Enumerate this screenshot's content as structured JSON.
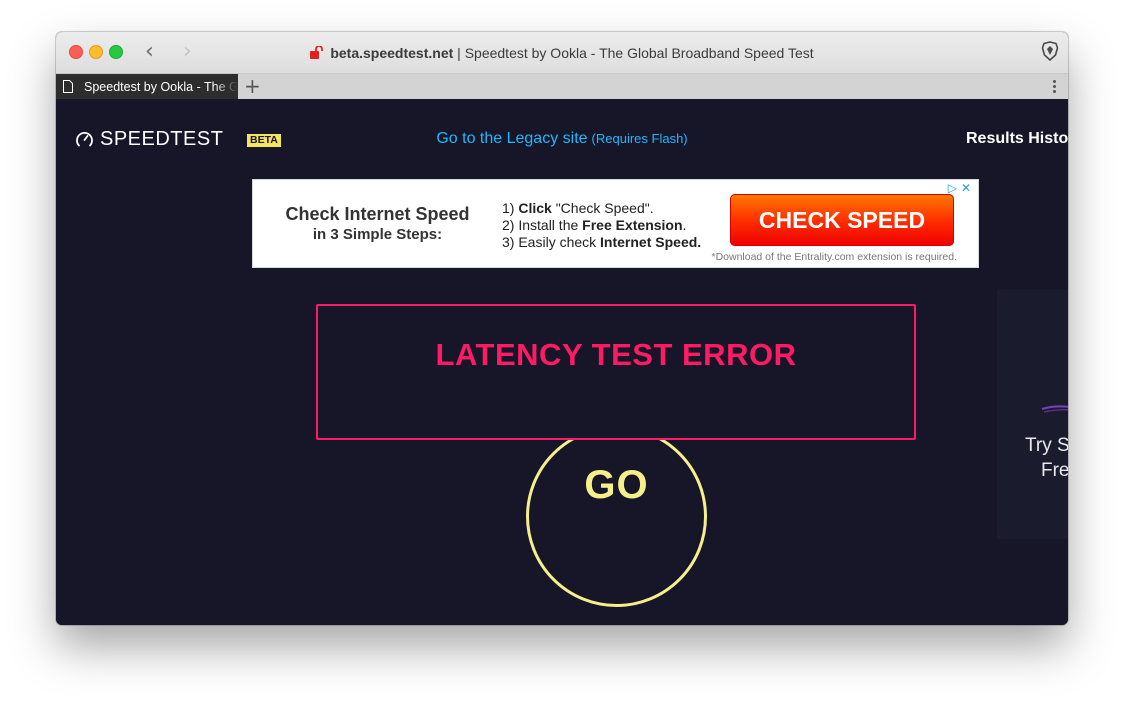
{
  "browser": {
    "domain": "beta.speedtest.net",
    "page_title_suffix": " | Speedtest by Ookla - The Global Broadband Speed Test",
    "tab_title": "Speedtest by Ookla - The Global Broadband Speed Test",
    "new_tab_label": "+",
    "back_label": "‹",
    "forward_label": "›",
    "icons": [
      "back-icon",
      "forward-icon",
      "lock-icon",
      "brave-shield-icon",
      "document-icon",
      "menu-icon"
    ],
    "lock_color": "#e02020"
  },
  "header": {
    "logo_text": "SPEEDTEST",
    "beta_badge": "BETA",
    "legacy_link": "Go to the Legacy site",
    "legacy_note": "(Requires Flash)",
    "results_history": "Results Histo"
  },
  "ad": {
    "headline_1": "Check Internet Speed",
    "headline_2": "in 3 Simple Steps:",
    "steps": [
      {
        "num": "1)",
        "bold": "Click",
        "rest": " \"Check Speed\"."
      },
      {
        "num": "2)",
        "pre": "Install the ",
        "bold": "Free Extension",
        "rest": "."
      },
      {
        "num": "3)",
        "pre": "Easily check ",
        "bold": "Internet Speed."
      }
    ],
    "button_label": "CHECK SPEED",
    "footnote": "*Download of the Entrality.com extension is required.",
    "choice_icon": "▷",
    "close_icon": "✕"
  },
  "side_promo": {
    "line_1": "Try S",
    "line_2": "Fre"
  },
  "main": {
    "error_text": "LATENCY TEST ERROR",
    "go_label": "GO"
  },
  "colors": {
    "page_bg": "#161628",
    "accent_blue": "#1fb8ff",
    "error": "#ff1a66",
    "go": "#f5f08a",
    "beta_badge": "#f5e55e",
    "ad_button": "#ff2a00"
  }
}
